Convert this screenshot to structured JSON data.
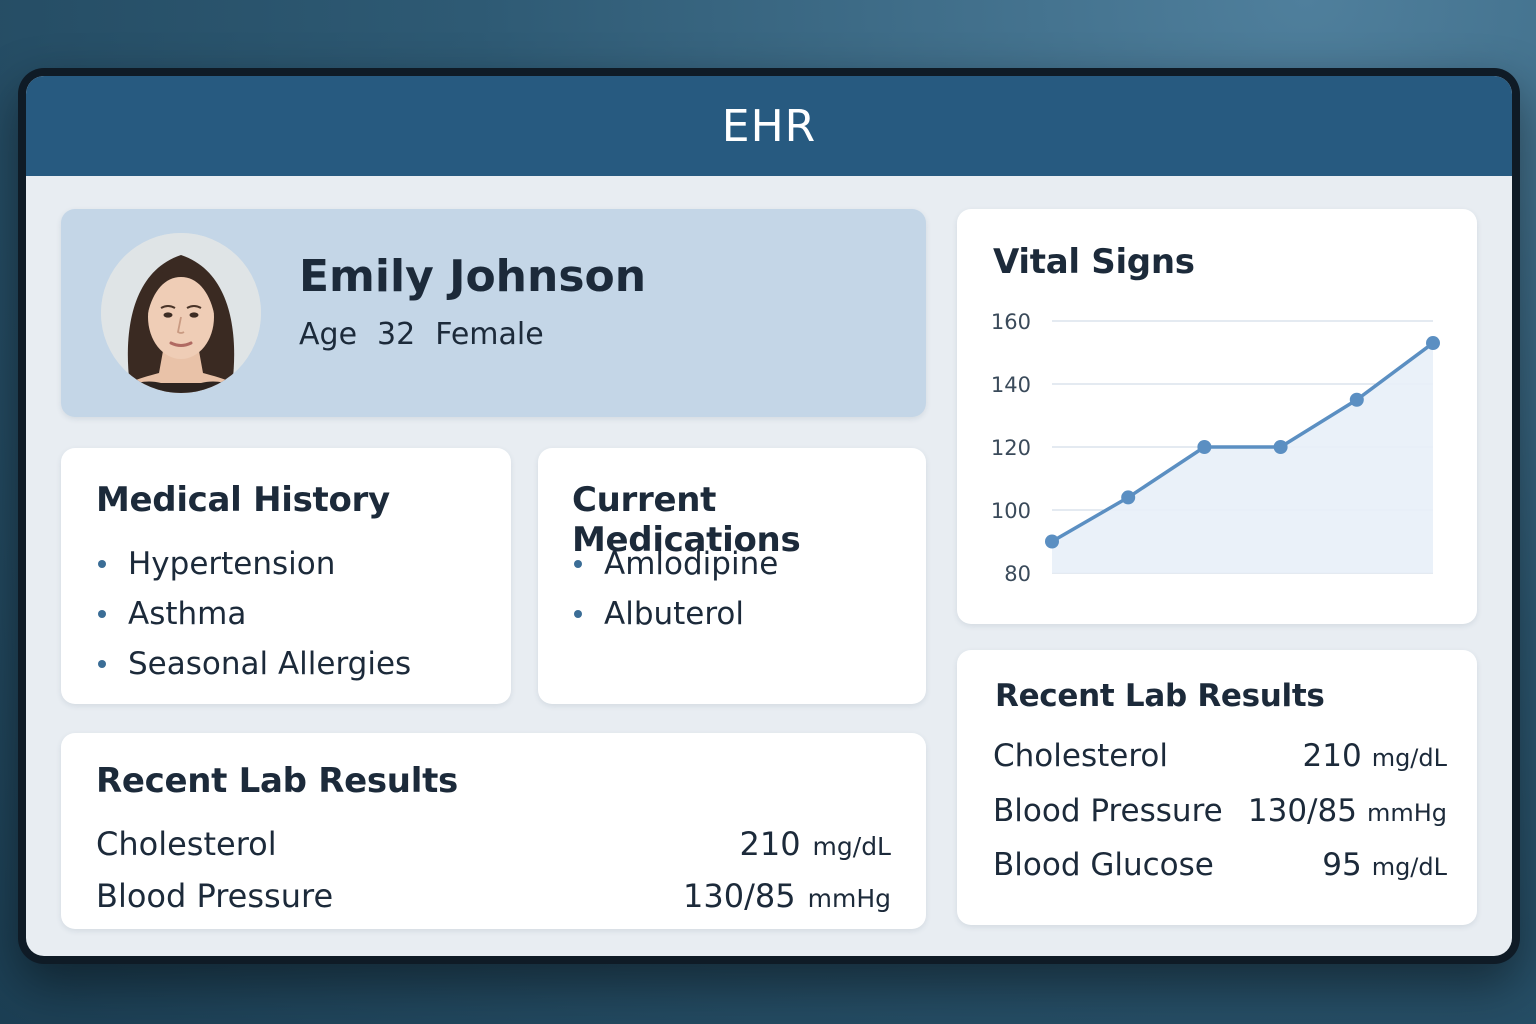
{
  "app": {
    "title": "EHR"
  },
  "patient": {
    "name": "Emily Johnson",
    "age_label": "Age",
    "age": "32",
    "sex": "Female",
    "avatar_icon": "patient-photo"
  },
  "medical_history": {
    "title": "Medical History",
    "items": [
      "Hypertension",
      "Asthma",
      "Seasonal Allergies"
    ]
  },
  "medications": {
    "title": "Current Medications",
    "items": [
      "Amlodipine",
      "Albuterol"
    ]
  },
  "labs_main": {
    "title": "Recent Lab Results",
    "rows": [
      {
        "name": "Cholesterol",
        "value": "210",
        "unit": "mg/dL"
      },
      {
        "name": "Blood Pressure",
        "value": "130/85",
        "unit": "mmHg"
      }
    ]
  },
  "labs_side": {
    "title": "Recent Lab Results",
    "rows": [
      {
        "name": "Cholesterol",
        "value": "210",
        "unit": "mg/dL"
      },
      {
        "name": "Blood Pressure",
        "value": "130/85",
        "unit": "mmHg"
      },
      {
        "name": "Blood Glucose",
        "value": "95",
        "unit": "mg/dL"
      }
    ]
  },
  "vitals": {
    "title": "Vital Signs"
  },
  "chart_data": {
    "type": "area",
    "title": "Vital Signs",
    "x": [
      1,
      2,
      3,
      4,
      5,
      6
    ],
    "series": [
      {
        "values": [
          90,
          104,
          120,
          120,
          135,
          153
        ]
      }
    ],
    "ylim": [
      80,
      160
    ],
    "yticks": [
      160,
      140,
      120,
      100,
      80
    ],
    "grid": true,
    "colors": {
      "line": "#5b8fc2",
      "fill": "#e8f0f8",
      "grid": "#c9d6e3"
    }
  },
  "colors": {
    "header": "#275a80",
    "patient_card": "#c4d6e7",
    "text": "#1c2a3a",
    "bullet": "#3b6d96"
  }
}
